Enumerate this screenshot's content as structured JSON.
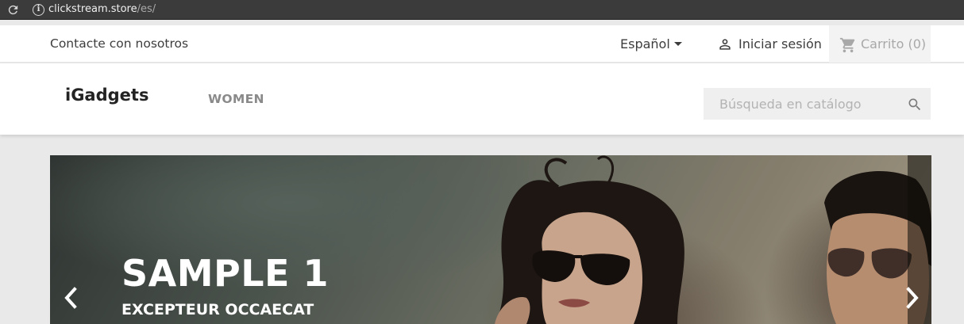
{
  "browser": {
    "url_host": "clickstream.store",
    "url_path": "/es/"
  },
  "topnav": {
    "contact": "Contacte con nosotros",
    "language": "Español",
    "login": "Iniciar sesión",
    "cart": "Carrito (0)"
  },
  "header": {
    "brand": "iGadgets",
    "menu": [
      {
        "label": "WOMEN"
      }
    ],
    "search_placeholder": "Búsqueda en catálogo"
  },
  "carousel": {
    "title": "SAMPLE 1",
    "subtitle": "EXCEPTEUR OCCAECAT"
  },
  "colors": {
    "page_bg": "#e9e9e9",
    "cart_bg": "#f3f3f3",
    "search_bg": "#efefef",
    "text": "#3d3d3d"
  },
  "icons": [
    "reload-icon",
    "info-icon",
    "caret-down-icon",
    "user-icon",
    "cart-icon",
    "search-icon",
    "chevron-left-icon",
    "chevron-right-icon"
  ]
}
